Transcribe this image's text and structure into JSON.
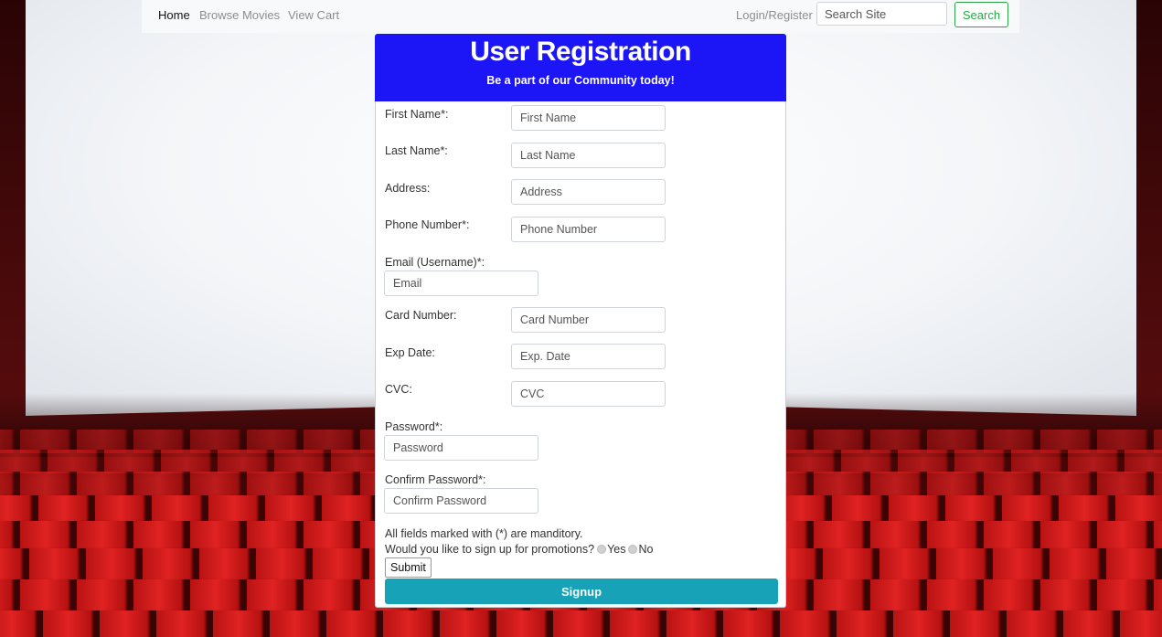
{
  "nav": {
    "home": "Home",
    "browse": "Browse Movies",
    "cart": "View Cart",
    "login": "Login/Register",
    "search_placeholder": "Search Site",
    "search_button": "Search"
  },
  "header": {
    "title": "User Registration",
    "subtitle": "Be a part of our Community today!"
  },
  "form": {
    "first_name": {
      "label": "First Name*:",
      "placeholder": "First Name"
    },
    "last_name": {
      "label": "Last Name*:",
      "placeholder": "Last Name"
    },
    "address": {
      "label": "Address:",
      "placeholder": "Address"
    },
    "phone": {
      "label": "Phone Number*:",
      "placeholder": "Phone Number"
    },
    "email": {
      "label": "Email (Username)*:",
      "placeholder": "Email"
    },
    "card": {
      "label": "Card Number:",
      "placeholder": "Card Number"
    },
    "exp": {
      "label": "Exp Date:",
      "placeholder": "Exp. Date"
    },
    "cvc": {
      "label": "CVC:",
      "placeholder": "CVC"
    },
    "password": {
      "label": "Password*:",
      "placeholder": "Password"
    },
    "confirm": {
      "label": "Confirm Password*:",
      "placeholder": "Confirm Password"
    },
    "required_note": "All fields marked with (*) are manditory.",
    "promo_question": "Would you like to sign up for promotions?",
    "promo_yes": "Yes",
    "promo_no": "No",
    "submit": "Submit",
    "signup": "Signup"
  },
  "colors": {
    "header_bg": "#1c16f7",
    "signup_bg": "#17a2b8",
    "search_green": "#28a745"
  }
}
